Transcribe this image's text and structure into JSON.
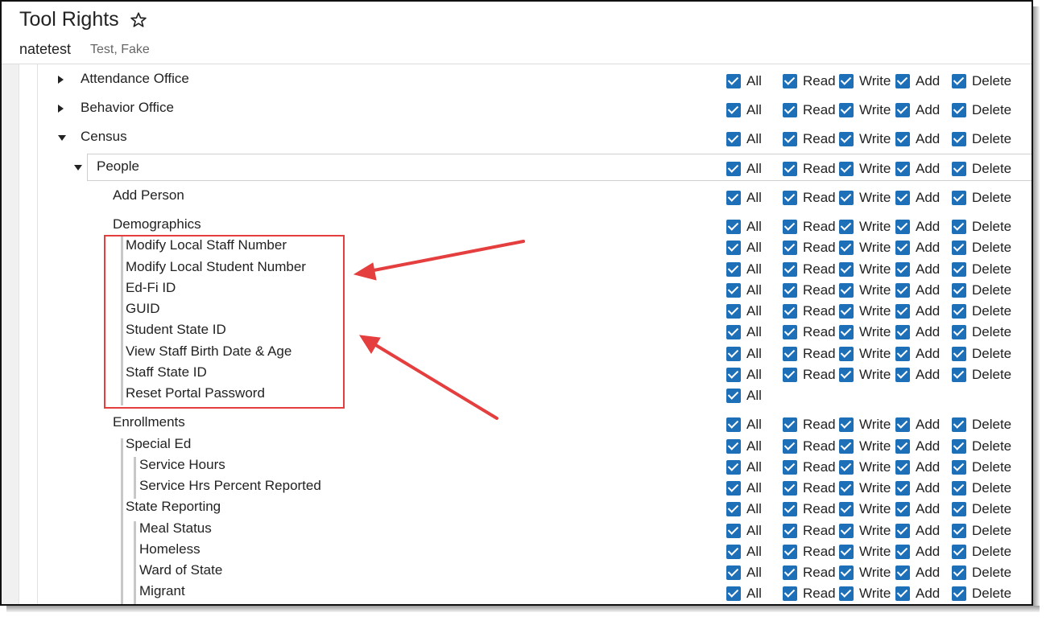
{
  "header": {
    "title": "Tool Rights",
    "star_icon": "star-icon",
    "username": "natetest",
    "person_name": "Test, Fake"
  },
  "permission_labels": {
    "all": "All",
    "read": "Read",
    "write": "Write",
    "add": "Add",
    "delete": "Delete"
  },
  "tree": [
    {
      "label": "Attendance Office",
      "expander": "collapsed",
      "permissions": [
        "All",
        "Read",
        "Write",
        "Add",
        "Delete"
      ],
      "checked": true
    },
    {
      "label": "Behavior Office",
      "expander": "collapsed",
      "permissions": [
        "All",
        "Read",
        "Write",
        "Add",
        "Delete"
      ],
      "checked": true
    },
    {
      "label": "Census",
      "expander": "expanded",
      "permissions": [
        "All",
        "Read",
        "Write",
        "Add",
        "Delete"
      ],
      "checked": true
    },
    {
      "label": "People",
      "expander": "expanded",
      "permissions": [
        "All",
        "Read",
        "Write",
        "Add",
        "Delete"
      ],
      "checked": true,
      "selected": true
    },
    {
      "label": "Add Person",
      "permissions": [
        "All",
        "Read",
        "Write",
        "Add",
        "Delete"
      ],
      "checked": true
    },
    {
      "label": "Demographics",
      "permissions": [
        "All",
        "Read",
        "Write",
        "Add",
        "Delete"
      ],
      "checked": true
    },
    {
      "label": "Modify Local Staff Number",
      "permissions": [
        "All",
        "Read",
        "Write",
        "Add",
        "Delete"
      ],
      "checked": true,
      "highlighted": true
    },
    {
      "label": "Modify Local Student Number",
      "permissions": [
        "All",
        "Read",
        "Write",
        "Add",
        "Delete"
      ],
      "checked": true,
      "highlighted": true
    },
    {
      "label": "Ed-Fi ID",
      "permissions": [
        "All",
        "Read",
        "Write",
        "Add",
        "Delete"
      ],
      "checked": true,
      "highlighted": true
    },
    {
      "label": "GUID",
      "permissions": [
        "All",
        "Read",
        "Write",
        "Add",
        "Delete"
      ],
      "checked": true,
      "highlighted": true
    },
    {
      "label": "Student State ID",
      "permissions": [
        "All",
        "Read",
        "Write",
        "Add",
        "Delete"
      ],
      "checked": true,
      "highlighted": true
    },
    {
      "label": "View Staff Birth Date & Age",
      "permissions": [
        "All",
        "Read",
        "Write",
        "Add",
        "Delete"
      ],
      "checked": true,
      "highlighted": true
    },
    {
      "label": "Staff State ID",
      "permissions": [
        "All",
        "Read",
        "Write",
        "Add",
        "Delete"
      ],
      "checked": true,
      "highlighted": true
    },
    {
      "label": "Reset Portal Password",
      "permissions": [
        "All"
      ],
      "checked": true,
      "highlighted": true
    },
    {
      "label": "Enrollments",
      "permissions": [
        "All",
        "Read",
        "Write",
        "Add",
        "Delete"
      ],
      "checked": true
    },
    {
      "label": "Special Ed",
      "permissions": [
        "All",
        "Read",
        "Write",
        "Add",
        "Delete"
      ],
      "checked": true
    },
    {
      "label": "Service Hours",
      "permissions": [
        "All",
        "Read",
        "Write",
        "Add",
        "Delete"
      ],
      "checked": true
    },
    {
      "label": "Service Hrs Percent Reported",
      "permissions": [
        "All",
        "Read",
        "Write",
        "Add",
        "Delete"
      ],
      "checked": true
    },
    {
      "label": "State Reporting",
      "permissions": [
        "All",
        "Read",
        "Write",
        "Add",
        "Delete"
      ],
      "checked": true
    },
    {
      "label": "Meal Status",
      "permissions": [
        "All",
        "Read",
        "Write",
        "Add",
        "Delete"
      ],
      "checked": true
    },
    {
      "label": "Homeless",
      "permissions": [
        "All",
        "Read",
        "Write",
        "Add",
        "Delete"
      ],
      "checked": true
    },
    {
      "label": "Ward of State",
      "permissions": [
        "All",
        "Read",
        "Write",
        "Add",
        "Delete"
      ],
      "checked": true
    },
    {
      "label": "Migrant",
      "permissions": [
        "All",
        "Read",
        "Write",
        "Add",
        "Delete"
      ],
      "checked": true
    }
  ],
  "annotation": {
    "box_color": "#e53e3e",
    "arrow_color": "#e53e3e",
    "arrow_count": 2
  },
  "colors": {
    "checkbox": "#1d6fb8",
    "text": "#222222",
    "secondary_text": "#666666"
  }
}
